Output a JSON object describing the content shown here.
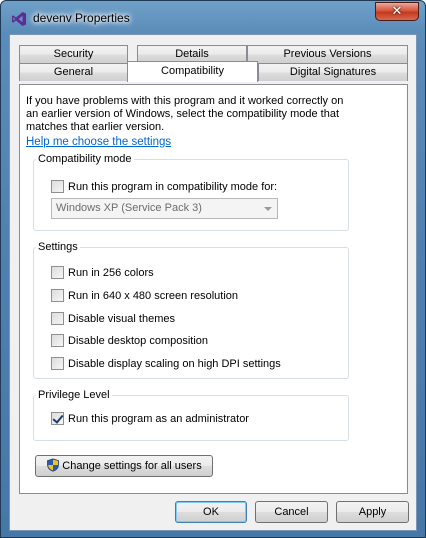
{
  "window": {
    "title": "devenv Properties",
    "close_symbol": "✕"
  },
  "tabs": {
    "row_top": [
      "Security",
      "Details",
      "Previous Versions"
    ],
    "row_bottom": [
      "General",
      "Compatibility",
      "Digital Signatures"
    ],
    "selected": "Compatibility"
  },
  "intro_text": "If you have problems with this program and it worked correctly on an earlier version of Windows, select the compatibility mode that matches that earlier version.",
  "help_link": "Help me choose the settings",
  "compat_mode": {
    "legend": "Compatibility mode",
    "checkbox_label": "Run this program in compatibility mode for:",
    "checked": false,
    "selected_os": "Windows XP (Service Pack 3)"
  },
  "settings": {
    "legend": "Settings",
    "items": [
      {
        "label": "Run in 256 colors",
        "checked": false
      },
      {
        "label": "Run in 640 x 480 screen resolution",
        "checked": false
      },
      {
        "label": "Disable visual themes",
        "checked": false
      },
      {
        "label": "Disable desktop composition",
        "checked": false
      },
      {
        "label": "Disable display scaling on high DPI settings",
        "checked": false
      }
    ]
  },
  "privilege": {
    "legend": "Privilege Level",
    "checkbox_label": "Run this program as an administrator",
    "checked": true
  },
  "change_all_users_label": "Change settings for all users",
  "buttons": {
    "ok": "OK",
    "cancel": "Cancel",
    "apply": "Apply"
  },
  "icons": {
    "app": "visual-studio-icon",
    "shield": "uac-shield-icon"
  }
}
